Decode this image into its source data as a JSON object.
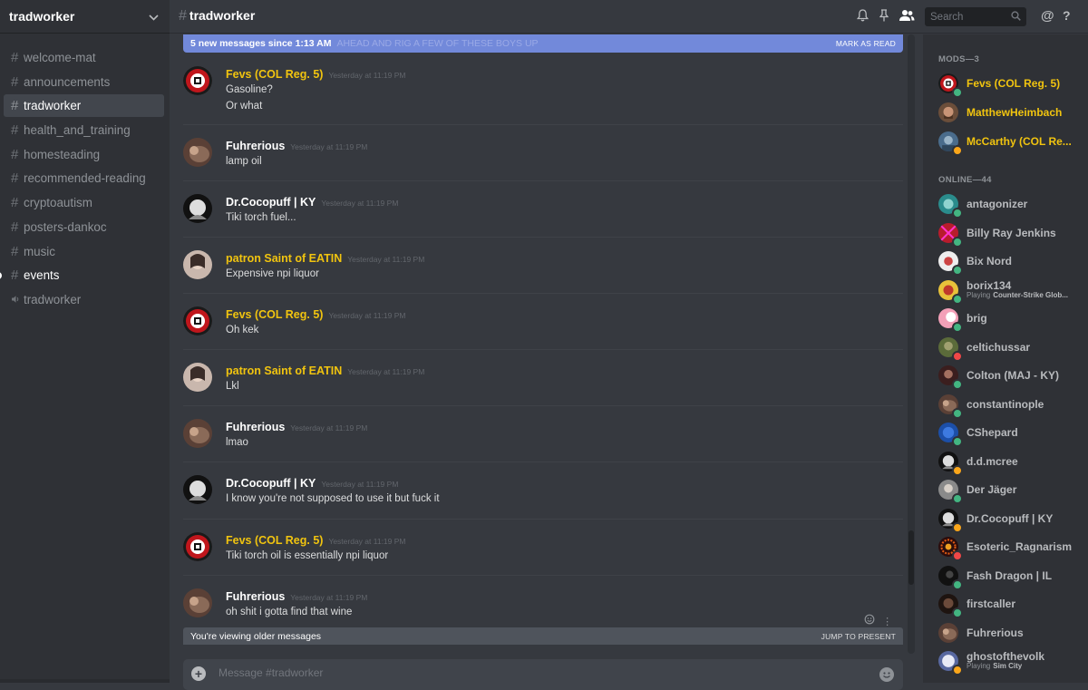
{
  "server": {
    "name": "tradworker"
  },
  "channels": [
    {
      "name": "welcome-mat",
      "icon": "hash-icon",
      "state": "normal"
    },
    {
      "name": "announcements",
      "icon": "hash-icon",
      "state": "normal"
    },
    {
      "name": "tradworker",
      "icon": "hash-icon",
      "state": "active"
    },
    {
      "name": "health_and_training",
      "icon": "hash-icon",
      "state": "normal"
    },
    {
      "name": "homesteading",
      "icon": "hash-icon",
      "state": "normal"
    },
    {
      "name": "recommended-reading",
      "icon": "hash-icon",
      "state": "normal"
    },
    {
      "name": "cryptoautism",
      "icon": "hash-icon",
      "state": "normal"
    },
    {
      "name": "posters-dankoc",
      "icon": "hash-icon",
      "state": "normal"
    },
    {
      "name": "music",
      "icon": "hash-icon",
      "state": "normal"
    },
    {
      "name": "events",
      "icon": "hash-icon",
      "state": "unread"
    },
    {
      "name": "tradworker",
      "icon": "speaker-icon",
      "state": "normal"
    }
  ],
  "topbar": {
    "channel": "tradworker",
    "search_placeholder": "Search"
  },
  "new_messages_bar": {
    "text": "5 new messages since 1:13 AM",
    "ghost_text": "AHEAD AND RIG A FEW OF THESE BOYS UP",
    "action": "MARK AS READ"
  },
  "messages": [
    {
      "author": "Fevs (COL Reg. 5)",
      "mod": true,
      "avatar": "red-emblem",
      "time": "Yesterday at 11:19 PM",
      "lines": [
        "Gasoline?",
        "Or what"
      ]
    },
    {
      "author": "Fuhrerious",
      "mod": false,
      "avatar": "brown",
      "time": "Yesterday at 11:19 PM",
      "lines": [
        "lamp oil"
      ]
    },
    {
      "author": "Dr.Cocopuff | KY",
      "mod": false,
      "avatar": "bw",
      "time": "Yesterday at 11:19 PM",
      "lines": [
        "Tiki torch fuel..."
      ]
    },
    {
      "author": "patron Saint of EATIN",
      "mod": true,
      "avatar": "photo",
      "time": "Yesterday at 11:19 PM",
      "lines": [
        "Expensive npi liquor"
      ]
    },
    {
      "author": "Fevs (COL Reg. 5)",
      "mod": true,
      "avatar": "red-emblem",
      "time": "Yesterday at 11:19 PM",
      "lines": [
        "Oh kek"
      ]
    },
    {
      "author": "patron Saint of EATIN",
      "mod": true,
      "avatar": "photo",
      "time": "Yesterday at 11:19 PM",
      "lines": [
        "Lkl"
      ]
    },
    {
      "author": "Fuhrerious",
      "mod": false,
      "avatar": "brown",
      "time": "Yesterday at 11:19 PM",
      "lines": [
        "lmao"
      ]
    },
    {
      "author": "Dr.Cocopuff | KY",
      "mod": false,
      "avatar": "bw",
      "time": "Yesterday at 11:19 PM",
      "lines": [
        "I know you're not supposed to use it but fuck it"
      ]
    },
    {
      "author": "Fevs (COL Reg. 5)",
      "mod": true,
      "avatar": "red-emblem",
      "time": "Yesterday at 11:19 PM",
      "lines": [
        "Tiki torch oil is essentially npi liquor"
      ]
    },
    {
      "author": "Fuhrerious",
      "mod": false,
      "avatar": "brown",
      "time": "Yesterday at 11:19 PM",
      "lines": [
        "oh shit i gotta find that wine"
      ]
    }
  ],
  "older_bar": {
    "text": "You're viewing older messages",
    "action": "JUMP TO PRESENT"
  },
  "composer": {
    "placeholder": "Message #tradworker"
  },
  "members": {
    "mods_header": "MODS—3",
    "online_header": "ONLINE—44",
    "mods": [
      {
        "name": "Fevs (COL Reg. 5)",
        "status": "online",
        "avatar": "red-emblem"
      },
      {
        "name": "MatthewHeimbach",
        "status": "none",
        "avatar": "photo-face"
      },
      {
        "name": "McCarthy (COL Re...",
        "status": "idle",
        "avatar": "photo-blue"
      }
    ],
    "online": [
      {
        "name": "antagonizer",
        "status": "online",
        "avatar": "teal"
      },
      {
        "name": "Billy Ray Jenkins",
        "status": "online",
        "avatar": "red"
      },
      {
        "name": "Bix Nord",
        "status": "online",
        "avatar": "white"
      },
      {
        "name": "borix134",
        "status": "online",
        "avatar": "yellow",
        "activity_prefix": "Playing",
        "activity": "Counter-Strike Glob..."
      },
      {
        "name": "brig",
        "status": "online",
        "avatar": "pink"
      },
      {
        "name": "celtichussar",
        "status": "dnd",
        "avatar": "olive"
      },
      {
        "name": "Colton (MAJ - KY)",
        "status": "online",
        "avatar": "dark-red"
      },
      {
        "name": "constantinople",
        "status": "online",
        "avatar": "brown"
      },
      {
        "name": "CShepard",
        "status": "online",
        "avatar": "blue"
      },
      {
        "name": "d.d.mcree",
        "status": "idle",
        "avatar": "bw"
      },
      {
        "name": "Der Jäger",
        "status": "online",
        "avatar": "grey"
      },
      {
        "name": "Dr.Cocopuff | KY",
        "status": "idle",
        "avatar": "bw2"
      },
      {
        "name": "Esoteric_Ragnarism",
        "status": "dnd",
        "avatar": "sun"
      },
      {
        "name": "Fash Dragon | IL",
        "status": "online",
        "avatar": "black"
      },
      {
        "name": "firstcaller",
        "status": "online",
        "avatar": "dark-face"
      },
      {
        "name": "Fuhrerious",
        "status": "none",
        "avatar": "brown2"
      },
      {
        "name": "ghostofthevolk",
        "status": "idle",
        "avatar": "moon",
        "activity_prefix": "Playing",
        "activity": "Sim City"
      }
    ]
  },
  "colors": {
    "background": "#36393f",
    "sidebar": "#2f3136",
    "accent": "#7289da",
    "mod_name": "#f1c40f",
    "online": "#43b581",
    "idle": "#faa61a",
    "dnd": "#f04747"
  }
}
